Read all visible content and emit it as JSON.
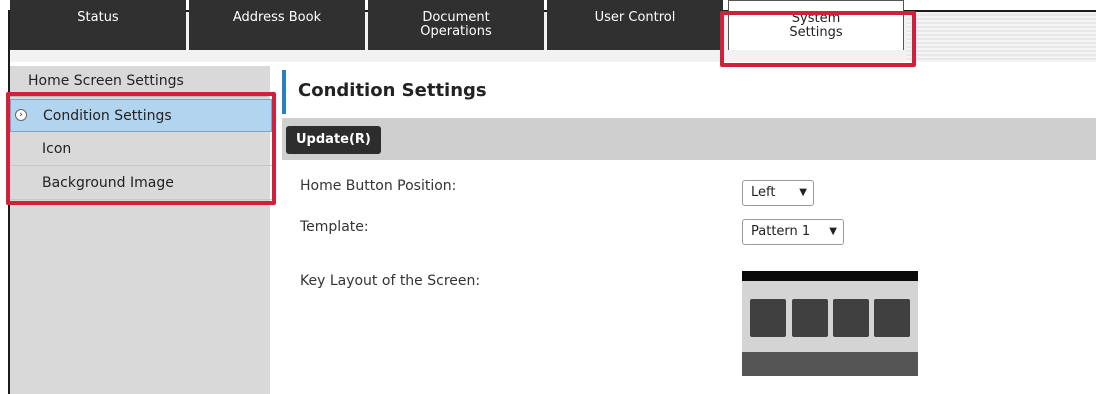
{
  "tabs": [
    {
      "label": "Status"
    },
    {
      "label": "Address Book"
    },
    {
      "label": "Document\nOperations"
    },
    {
      "label": "User Control"
    },
    {
      "label": "System\nSettings"
    }
  ],
  "sidebar": {
    "title": "Home Screen Settings",
    "items": [
      {
        "label": "Condition Settings"
      },
      {
        "label": "Icon"
      },
      {
        "label": "Background Image"
      }
    ]
  },
  "main": {
    "heading": "Condition Settings",
    "update_label": "Update(R)",
    "fields": {
      "home_button_position": {
        "label": "Home Button Position:",
        "value": "Left"
      },
      "template": {
        "label": "Template:",
        "value": "Pattern 1"
      },
      "key_layout": {
        "label": "Key Layout of the Screen:"
      }
    }
  },
  "colors": {
    "highlight": "#d0203a",
    "accent": "#2b7fc1"
  }
}
